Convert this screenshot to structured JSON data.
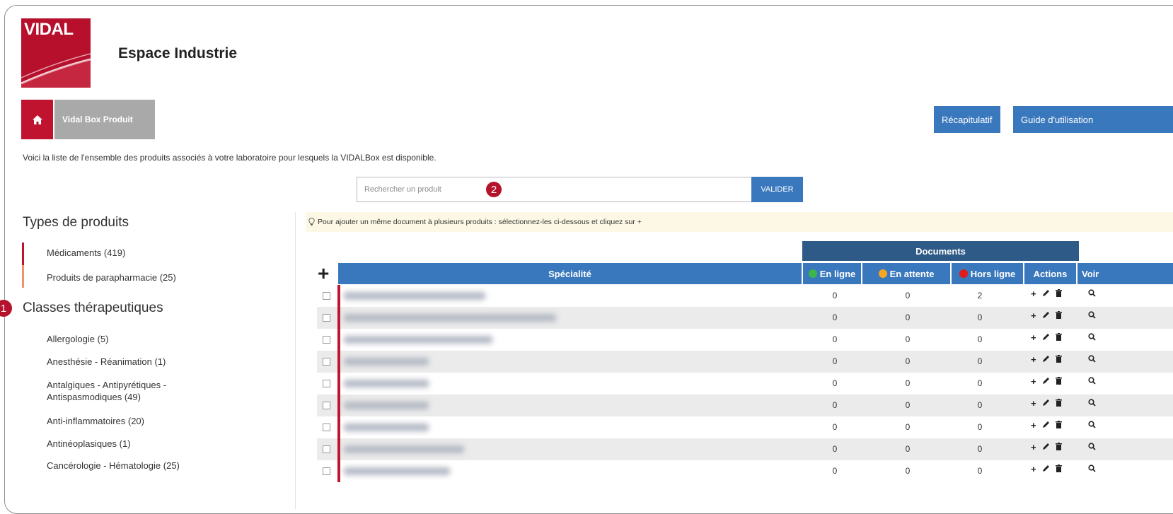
{
  "header": {
    "logo_text": "VIDAL",
    "app_title": "Espace Industrie"
  },
  "breadcrumb": {
    "current": "Vidal Box Produit"
  },
  "top_buttons": {
    "summary": "Récapitulatif",
    "guide": "Guide d'utilisation"
  },
  "intro_text": "Voici la liste de l'ensemble des produits associés à votre laboratoire pour lesquels la VIDALBox est disponible.",
  "search": {
    "placeholder": "Rechercher un produit",
    "submit": "VALIDER"
  },
  "callouts": [
    "1",
    "2"
  ],
  "sidebar": {
    "types_title": "Types de produits",
    "types": [
      {
        "label": "Médicaments (419)",
        "color": "#c0132f"
      },
      {
        "label": "Produits de parapharmacie (25)",
        "color": "#f0936a"
      }
    ],
    "classes_title": "Classes thérapeutiques",
    "classes": [
      "Allergologie (5)",
      "Anesthésie - Réanimation (1)",
      "Antalgiques - Antipyrétiques - Antispasmodiques (49)",
      "Anti-inflammatoires (20)",
      "Antinéoplasiques (1)",
      "Cancérologie - Hématologie (25)"
    ]
  },
  "tip": "Pour ajouter un même document à plusieurs produits : sélectionnez-les ci-dessous et cliquez sur +",
  "table": {
    "group_header": "Documents",
    "columns": {
      "specialite": "Spécialité",
      "en_ligne": "En ligne",
      "en_attente": "En attente",
      "hors_ligne": "Hors ligne",
      "actions": "Actions",
      "voir": "Voir"
    },
    "status_colors": {
      "en_ligne": "#3cb54a",
      "en_attente": "#f5a623",
      "hors_ligne": "#e01b1b"
    },
    "rows": [
      {
        "en_ligne": "0",
        "en_attente": "0",
        "hors_ligne": "2"
      },
      {
        "en_ligne": "0",
        "en_attente": "0",
        "hors_ligne": "0"
      },
      {
        "en_ligne": "0",
        "en_attente": "0",
        "hors_ligne": "0"
      },
      {
        "en_ligne": "0",
        "en_attente": "0",
        "hors_ligne": "0"
      },
      {
        "en_ligne": "0",
        "en_attente": "0",
        "hors_ligne": "0"
      },
      {
        "en_ligne": "0",
        "en_attente": "0",
        "hors_ligne": "0"
      },
      {
        "en_ligne": "0",
        "en_attente": "0",
        "hors_ligne": "0"
      },
      {
        "en_ligne": "0",
        "en_attente": "0",
        "hors_ligne": "0"
      },
      {
        "en_ligne": "0",
        "en_attente": "0",
        "hors_ligne": "0"
      }
    ],
    "icons": {
      "add": "plus-icon",
      "edit": "pencil-icon",
      "delete": "trash-icon",
      "view": "magnifier-icon"
    }
  },
  "colors": {
    "brand": "#c0132f",
    "accent": "#3a78be",
    "header_dark": "#2d5a86"
  }
}
